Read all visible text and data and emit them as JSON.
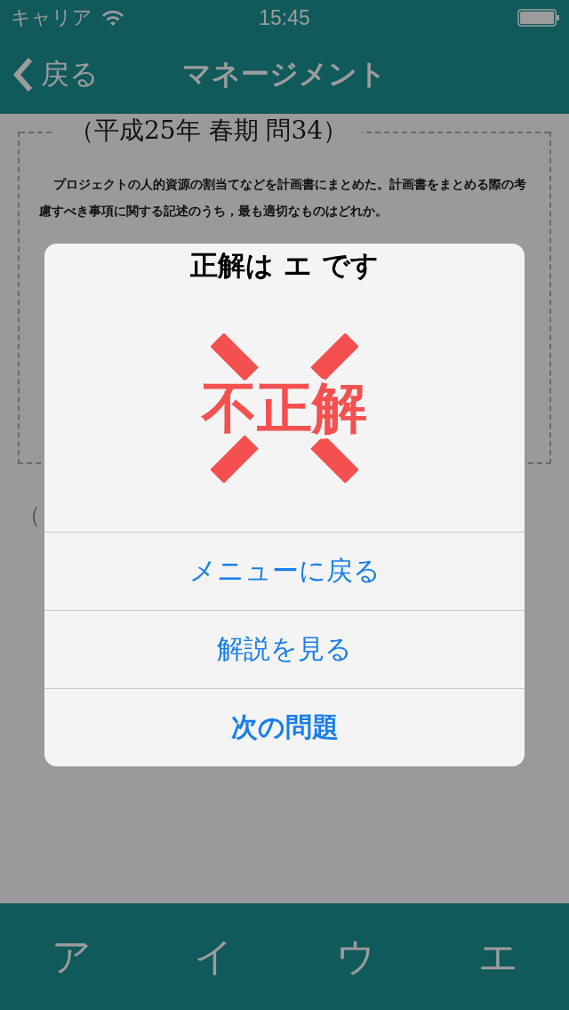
{
  "status_bar": {
    "carrier": "キャリア",
    "time": "15:45"
  },
  "nav_bar": {
    "back": "戻る",
    "title": "マネージメント"
  },
  "question": {
    "heading": "（平成25年 春期 問34）",
    "body": "プロジェクトの人的資源の割当てなどを計画書にまとめた。計画書をまとめる際の考慮すべき事項に関する記述のうち，最も適切なものはどれか。",
    "answer_note": "（"
  },
  "alert": {
    "title": "正解は エ です",
    "stamp": "不正解",
    "buttons": [
      {
        "label": "メニューに戻る",
        "emphasized": false
      },
      {
        "label": "解説を見る",
        "emphasized": false
      },
      {
        "label": "次の問題",
        "emphasized": true
      }
    ]
  },
  "answer_bar": [
    {
      "label": "ア"
    },
    {
      "label": "イ"
    },
    {
      "label": "ウ"
    },
    {
      "label": "エ"
    }
  ]
}
